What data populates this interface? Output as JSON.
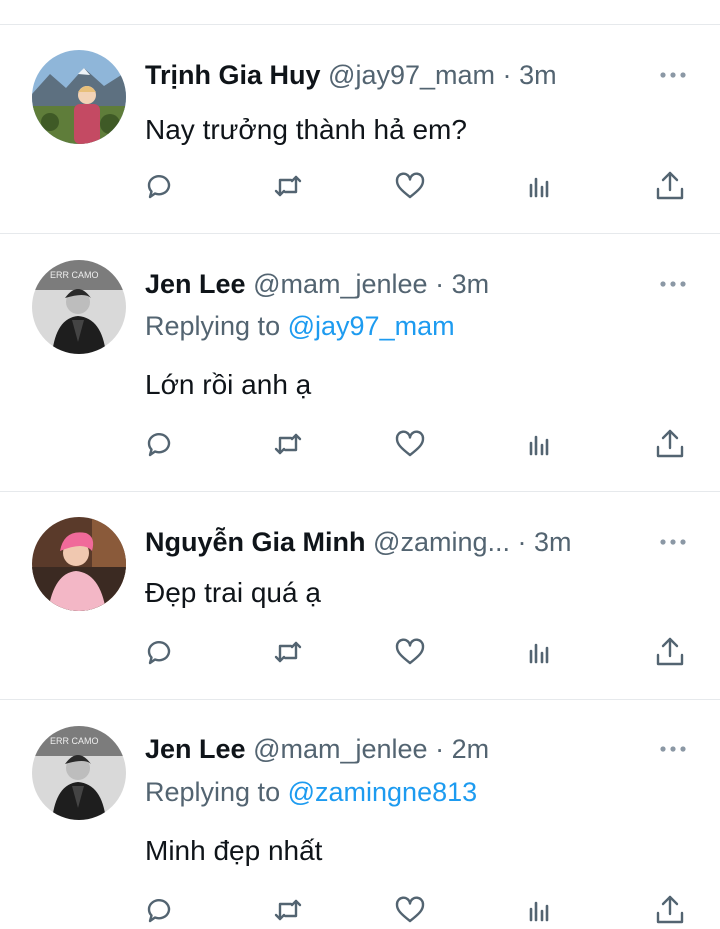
{
  "tweets": [
    {
      "name": "Trịnh Gia Huy",
      "handle": "@jay97_mam",
      "separator": "·",
      "time": "3m",
      "replying_prefix": "",
      "replying_to": "",
      "text": "Nay trưởng thành hả em?",
      "avatar": "avatar-landscape-person"
    },
    {
      "name": "Jen Lee",
      "handle": "@mam_jenlee",
      "separator": "·",
      "time": "3m",
      "replying_prefix": "Replying to",
      "replying_to": "@jay97_mam",
      "text": "Lớn rồi anh ạ",
      "avatar": "avatar-bw-person"
    },
    {
      "name": "Nguyễn Gia Minh",
      "handle": "@zaming...",
      "separator": "·",
      "time": "3m",
      "replying_prefix": "",
      "replying_to": "",
      "text": "Đẹp trai quá ạ",
      "avatar": "avatar-pink-hair-person"
    },
    {
      "name": "Jen Lee",
      "handle": "@mam_jenlee",
      "separator": "·",
      "time": "2m",
      "replying_prefix": "Replying to",
      "replying_to": "@zamingne813",
      "text": "Minh đẹp nhất",
      "avatar": "avatar-bw-person"
    }
  ],
  "icons": [
    "reply-icon",
    "retweet-icon",
    "like-icon",
    "analytics-icon",
    "share-icon",
    "more-icon"
  ],
  "colors": {
    "text": "#0f1419",
    "secondary": "#536471",
    "link": "#1d9bf0",
    "divider": "#e6e9ec"
  }
}
